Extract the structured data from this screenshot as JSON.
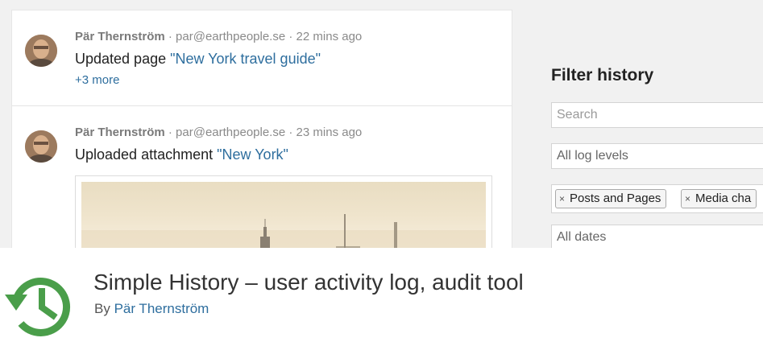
{
  "history": {
    "entries": [
      {
        "user": "Pär Thernström",
        "separator_1": " · ",
        "email": "par@earthpeople.se",
        "separator_2": " · ",
        "time": "22 mins ago",
        "action": "Updated page ",
        "object": "\"New York travel guide\"",
        "more": "+3 more"
      },
      {
        "user": "Pär Thernström",
        "separator_1": " · ",
        "email": "par@earthpeople.se",
        "separator_2": " · ",
        "time": "23 mins ago",
        "action": "Uploaded attachment ",
        "object": "\"New York\""
      }
    ]
  },
  "filters": {
    "title": "Filter history",
    "search_placeholder": "Search",
    "log_levels": "All log levels",
    "tags": [
      "Posts and Pages",
      "Media cha"
    ],
    "tag_remove": "×",
    "dates": "All dates"
  },
  "plugin": {
    "title": "Simple History – user activity log, audit tool",
    "by_label": "By ",
    "author": "Pär Thernström",
    "logo_icon": "history-clock-icon",
    "accent_color": "#4a9e4a",
    "link_color": "#2e6e9e"
  }
}
